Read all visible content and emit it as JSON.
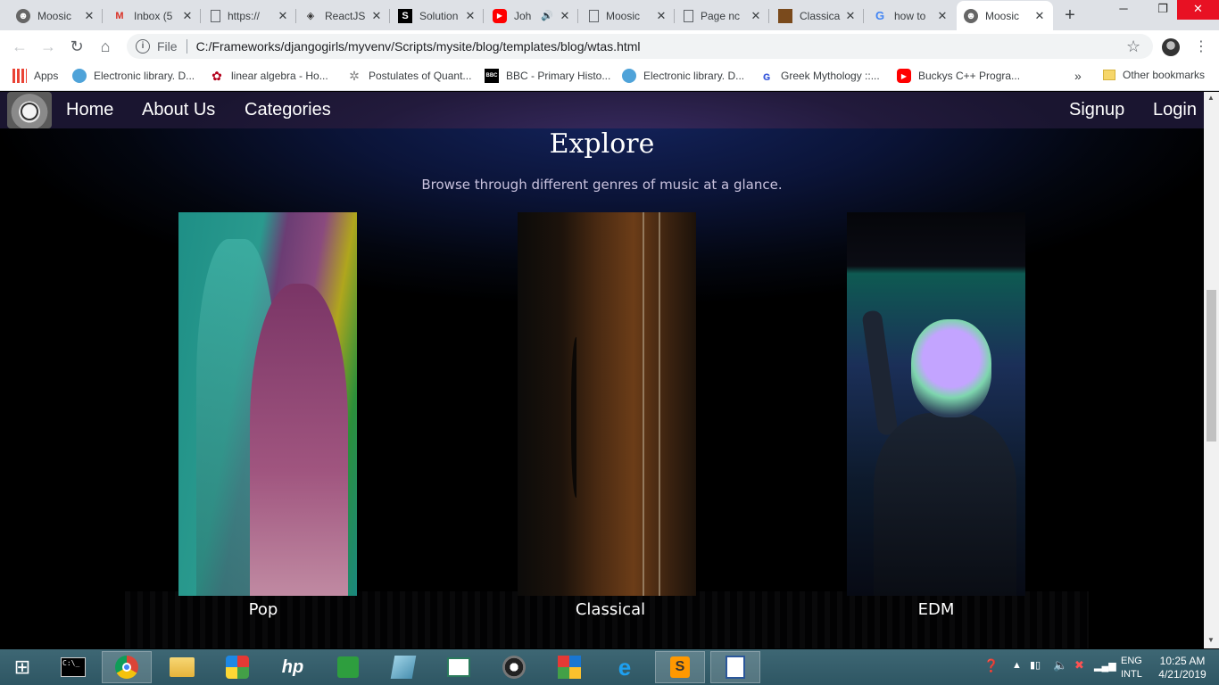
{
  "browser": {
    "tabs": [
      {
        "title": "Moosic",
        "icon": "moosic-icon"
      },
      {
        "title": "Inbox (5",
        "icon": "gmail-icon"
      },
      {
        "title": "https://",
        "icon": "page-icon"
      },
      {
        "title": "ReactJS",
        "icon": "reactjs-icon"
      },
      {
        "title": "Solution",
        "icon": "s-icon"
      },
      {
        "title": "Joh",
        "icon": "youtube-icon"
      },
      {
        "title": "Moosic",
        "icon": "page-icon"
      },
      {
        "title": "Page nc",
        "icon": "page-icon"
      },
      {
        "title": "Classica",
        "icon": "classical-icon"
      },
      {
        "title": "how to",
        "icon": "google-icon"
      },
      {
        "title": "Moosic",
        "icon": "moosic-icon",
        "active": true
      }
    ],
    "address": {
      "scheme": "File",
      "url": "C:/Frameworks/djangogirls/myvenv/Scripts/mysite/blog/templates/blog/wtas.html"
    },
    "bookmarks": [
      {
        "label": "Apps",
        "icon": "apps-grid-icon"
      },
      {
        "label": "Electronic library. D...",
        "icon": "globe-icon"
      },
      {
        "label": "linear algebra - Ho...",
        "icon": "flower-icon"
      },
      {
        "label": "Postulates of Quant...",
        "icon": "sparkle-icon"
      },
      {
        "label": "BBC - Primary Histo...",
        "icon": "bbc-icon"
      },
      {
        "label": "Electronic library. D...",
        "icon": "globe-icon"
      },
      {
        "label": "Greek Mythology ::...",
        "icon": "g-icon"
      },
      {
        "label": "Buckys C++ Progra...",
        "icon": "youtube-icon"
      }
    ],
    "more_bookmarks": "»",
    "other_bookmarks": "Other bookmarks"
  },
  "site": {
    "nav": {
      "home": "Home",
      "about": "About Us",
      "categories": "Categories",
      "signup": "Signup",
      "login": "Login"
    },
    "heading": "Explore",
    "subtitle": "Browse through different genres of music at a glance.",
    "genres": [
      {
        "label": "Pop"
      },
      {
        "label": "Classical"
      },
      {
        "label": "EDM"
      }
    ]
  },
  "taskbar": {
    "language": "ENG",
    "layout": "INTL",
    "time": "10:25 AM",
    "date": "4/21/2019"
  },
  "colors": {
    "tabstrip": "#dee1e6",
    "page_bg": "#03060f",
    "nav_bg": "#221a3c",
    "subtitle": "#c9c2de",
    "taskbar": "#2e5663"
  }
}
